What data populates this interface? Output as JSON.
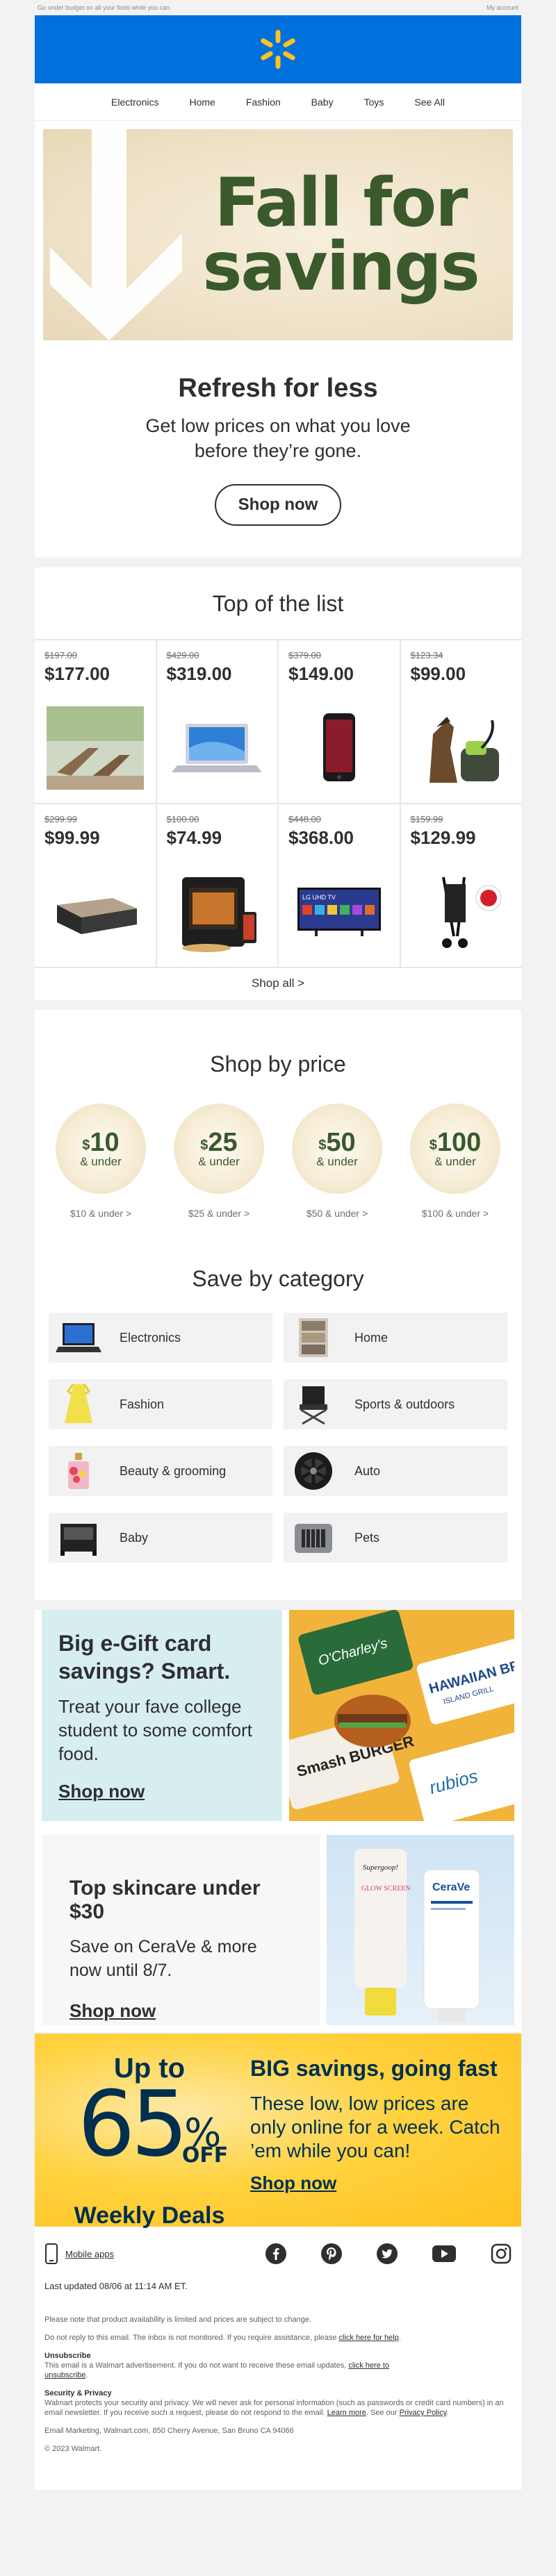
{
  "preheader": {
    "left": "Go under budget on all your finds while you can.",
    "right": "My account"
  },
  "nav": [
    "Electronics",
    "Home",
    "Fashion",
    "Baby",
    "Toys",
    "See All"
  ],
  "hero": {
    "title_line1": "Fall for",
    "title_line2": "savings",
    "heading": "Refresh for less",
    "body": "Get low prices on what you love before they’re gone.",
    "cta": "Shop now"
  },
  "top_list": {
    "title": "Top of the list",
    "products": [
      {
        "was": "$197.00",
        "now": "$177.00",
        "icon": "patio-chairs"
      },
      {
        "was": "$429.00",
        "now": "$319.00",
        "icon": "laptop"
      },
      {
        "was": "$379.00",
        "now": "$149.00",
        "icon": "smartphone"
      },
      {
        "was": "$123.34",
        "now": "$99.00",
        "icon": "carpet-cleaner"
      },
      {
        "was": "$299.99",
        "now": "$99.99",
        "icon": "air-mattress"
      },
      {
        "was": "$100.00",
        "now": "$74.99",
        "icon": "air-fryer"
      },
      {
        "was": "$448.00",
        "now": "$368.00",
        "icon": "television"
      },
      {
        "was": "$159.99",
        "now": "$129.99",
        "icon": "stroller"
      }
    ],
    "tv_label": "LG UHD TV",
    "shop_all": "Shop all >"
  },
  "by_price": {
    "title": "Shop by price",
    "items": [
      {
        "amount": "10",
        "under": "& under",
        "link": "$10 & under >"
      },
      {
        "amount": "25",
        "under": "& under",
        "link": "$25 & under >"
      },
      {
        "amount": "50",
        "under": "& under",
        "link": "$50 & under >"
      },
      {
        "amount": "100",
        "under": "& under",
        "link": "$100 & under >"
      }
    ]
  },
  "by_category": {
    "title": "Save by category",
    "items": [
      {
        "label": "Electronics",
        "icon": "laptop"
      },
      {
        "label": "Home",
        "icon": "shelf"
      },
      {
        "label": "Fashion",
        "icon": "dress"
      },
      {
        "label": "Sports & outdoors",
        "icon": "camp-chair"
      },
      {
        "label": "Beauty & grooming",
        "icon": "perfume"
      },
      {
        "label": "Auto",
        "icon": "wheel"
      },
      {
        "label": "Baby",
        "icon": "playard"
      },
      {
        "label": "Pets",
        "icon": "pet-crate"
      }
    ]
  },
  "gift": {
    "heading": "Big e-Gift card savings? Smart.",
    "body": "Treat your fave college student to some comfort food.",
    "cta": "Shop now",
    "cards": [
      "O'Charley's",
      "HAWAIIAN BR",
      "ISLAND GRILL",
      "Smash BURGER",
      "rubios"
    ]
  },
  "skincare": {
    "heading": "Top skincare under $30",
    "body": "Save on CeraVe & more now until 8/7.",
    "cta": "Shop now",
    "brands": [
      "Supergoop!",
      "GLOW SCREEN",
      "CeraVe"
    ]
  },
  "weekly": {
    "up_to": "Up to",
    "percent": "65",
    "pct_sign": "%",
    "off": "OFF",
    "label": "Weekly Deals",
    "heading": "BIG savings, going fast",
    "body": "These low, low prices are only online for a week. Catch ’em while you can!",
    "cta": "Shop now"
  },
  "footer": {
    "mobile_apps": "Mobile apps",
    "social": [
      "facebook",
      "pinterest",
      "twitter",
      "youtube",
      "instagram"
    ],
    "updated": "Last updated 08/06 at 11:14 AM ET.",
    "note1": "Please note that product availability is limited and prices are subject to change.",
    "note2_a": "Do not reply to this email. The inbox is not monitored. If you require assistance, please",
    "note2_link": "click here for help",
    "unsub_title": "Unsubscribe",
    "unsub_a": "This email is a Walmart advertisement. If you do not want to receive these email updates,",
    "unsub_link1": "click here to",
    "unsub_link2": "unsubscribe",
    "privacy_title": "Security & Privacy",
    "privacy_a": "Walmart protects your security and privacy. We will never ask for personal information (such as passwords or credit card numbers) in an email newsletter. If you receive such a request, please do not respond to the email.",
    "learn_more": "Learn more",
    "privacy_b": "See our",
    "privacy_link": "Privacy Policy",
    "address": "Email Marketing, Walmart.com, 850 Cherry Avenue, San Bruno CA 94066",
    "copyright": "© 2023 Walmart."
  },
  "colors": {
    "brand_blue": "#0071dc",
    "spark_yellow": "#ffc220",
    "hero_green": "#3a5a2c"
  }
}
